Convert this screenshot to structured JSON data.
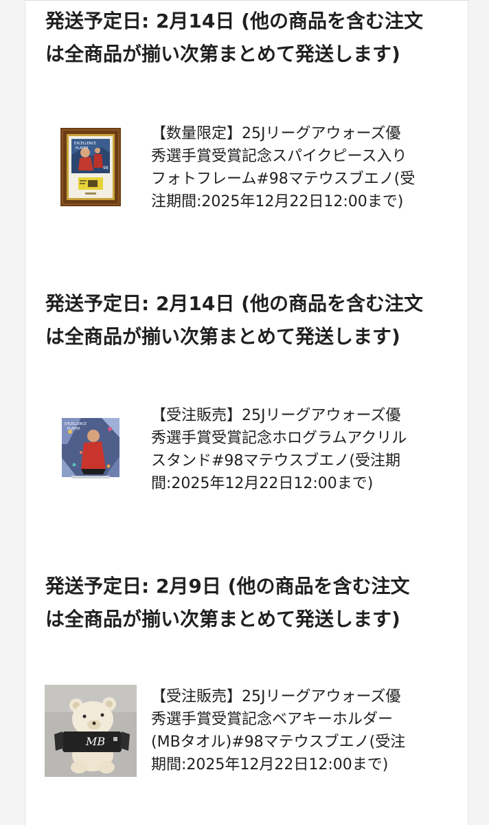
{
  "shipments": [
    {
      "heading_lines": [
        "発送予定日: 2月14日 (他の商品を含む注文",
        "は全商品が揃い次第まとめて発送します)"
      ],
      "product": {
        "thumb_icon": "framed-photo-icon",
        "name_lines": [
          "【数量限定】25Jリーグアウォーズ優",
          "秀選手賞受賞記念スパイクピース入り",
          "フォトフレーム#98マテウスブエノ(受",
          "注期間:2025年12月22日12:00まで)"
        ]
      }
    },
    {
      "heading_lines": [
        "発送予定日: 2月14日 (他の商品を含む注文",
        "は全商品が揃い次第まとめて発送します)"
      ],
      "product": {
        "thumb_icon": "hologram-acrylic-stand-icon",
        "name_lines": [
          "【受注販売】25Jリーグアウォーズ優",
          "秀選手賞受賞記念ホログラムアクリル",
          "スタンド#98マテウスブエノ(受注期",
          "間:2025年12月22日12:00まで)"
        ]
      }
    },
    {
      "heading_lines": [
        "発送予定日: 2月9日 (他の商品を含む注文",
        "は全商品が揃い次第まとめて発送します)"
      ],
      "product": {
        "thumb_icon": "bear-keyholder-icon",
        "name_lines": [
          "【受注販売】25Jリーグアウォーズ優",
          "秀選手賞受賞記念ベアキーホルダー",
          "(MBタオル)#98マテウスブエノ(受注",
          "期間:2025年12月22日12:00まで)"
        ]
      }
    }
  ],
  "thumb_lettering": {
    "frame": [
      "EXCELLENCE",
      "PLAYER",
      "98"
    ],
    "acrylic": [
      "EXCELLENCE",
      "PLAYER"
    ],
    "bear_towel": "MB"
  },
  "colors": {
    "page_bg": "#f4f4f5",
    "panel_bg": "#ffffff",
    "text": "#1f1f1f",
    "frame_wood": "#6b3e14",
    "frame_gold": "#c9a43a"
  }
}
